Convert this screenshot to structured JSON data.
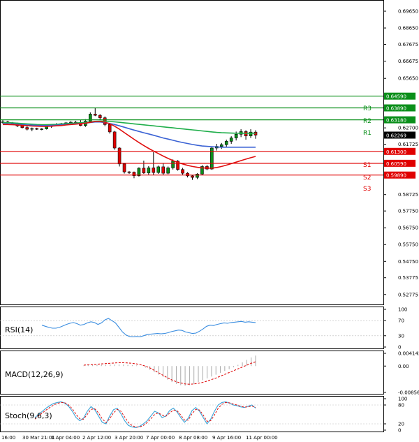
{
  "chart_data": [
    {
      "type": "candlestick",
      "panel": "price",
      "y_ticks": [
        "0.69650",
        "0.68650",
        "0.67675",
        "0.66675",
        "0.65650",
        "0.62700",
        "0.61725",
        "0.58725",
        "0.57750",
        "0.56750",
        "0.55750",
        "0.54750",
        "0.53775",
        "0.52775"
      ],
      "y_tick_values": [
        0.6965,
        0.6865,
        0.67675,
        0.66675,
        0.6565,
        0.627,
        0.61725,
        0.58725,
        0.5775,
        0.5675,
        0.5575,
        0.5475,
        0.53775,
        0.52775
      ],
      "ylim": [
        0.5235,
        0.7015
      ],
      "x_ticks": [
        "16:00",
        "30 Mar 21:01",
        "1 Apr 04:00",
        "2 Apr 12:00",
        "3 Apr 20:00",
        "7 Apr 00:00",
        "8 Apr 08:00",
        "9 Apr 16:00",
        "11 Apr 00:00"
      ],
      "current_price": "0.62269",
      "current_price_value": 0.62269,
      "levels": [
        {
          "name": "",
          "value": 0.6459,
          "label": "0.64590",
          "color": "#0a8f1a"
        },
        {
          "name": "R3",
          "value": 0.6389,
          "label": "0.63890",
          "color": "#0a8f1a"
        },
        {
          "name": "R2",
          "value": 0.6318,
          "label": "0.63180",
          "color": "#0a8f1a"
        },
        {
          "name": "R1",
          "value": 0.6318,
          "label": "",
          "color": "#0a8f1a"
        },
        {
          "name": "S1",
          "value": 0.613,
          "label": "0.61300",
          "color": "#e00000"
        },
        {
          "name": "S2",
          "value": 0.6059,
          "label": "0.60590",
          "color": "#e00000"
        },
        {
          "name": "S3",
          "value": 0.5989,
          "label": "0.59890",
          "color": "#e00000"
        }
      ],
      "candles": [
        {
          "o": 0.6302,
          "h": 0.6318,
          "l": 0.6295,
          "c": 0.6306
        },
        {
          "o": 0.6306,
          "h": 0.6312,
          "l": 0.6296,
          "c": 0.63
        },
        {
          "o": 0.63,
          "h": 0.6305,
          "l": 0.629,
          "c": 0.6296
        },
        {
          "o": 0.6296,
          "h": 0.6301,
          "l": 0.6275,
          "c": 0.6282
        },
        {
          "o": 0.6282,
          "h": 0.6292,
          "l": 0.6266,
          "c": 0.6272
        },
        {
          "o": 0.6272,
          "h": 0.6284,
          "l": 0.6255,
          "c": 0.6262
        },
        {
          "o": 0.6262,
          "h": 0.6272,
          "l": 0.625,
          "c": 0.6266
        },
        {
          "o": 0.6266,
          "h": 0.6271,
          "l": 0.6258,
          "c": 0.6262
        },
        {
          "o": 0.6262,
          "h": 0.6268,
          "l": 0.6256,
          "c": 0.6264
        },
        {
          "o": 0.6264,
          "h": 0.6281,
          "l": 0.626,
          "c": 0.6278
        },
        {
          "o": 0.6278,
          "h": 0.629,
          "l": 0.627,
          "c": 0.6286
        },
        {
          "o": 0.6286,
          "h": 0.6298,
          "l": 0.628,
          "c": 0.6292
        },
        {
          "o": 0.6292,
          "h": 0.63,
          "l": 0.6285,
          "c": 0.6295
        },
        {
          "o": 0.6295,
          "h": 0.6305,
          "l": 0.6288,
          "c": 0.63
        },
        {
          "o": 0.63,
          "h": 0.631,
          "l": 0.6292,
          "c": 0.6304
        },
        {
          "o": 0.6304,
          "h": 0.6312,
          "l": 0.629,
          "c": 0.6298
        },
        {
          "o": 0.6298,
          "h": 0.6318,
          "l": 0.628,
          "c": 0.6284
        },
        {
          "o": 0.6284,
          "h": 0.6322,
          "l": 0.6276,
          "c": 0.631
        },
        {
          "o": 0.631,
          "h": 0.6362,
          "l": 0.6305,
          "c": 0.6352
        },
        {
          "o": 0.6352,
          "h": 0.6388,
          "l": 0.634,
          "c": 0.6345
        },
        {
          "o": 0.6345,
          "h": 0.6352,
          "l": 0.632,
          "c": 0.633
        },
        {
          "o": 0.633,
          "h": 0.6338,
          "l": 0.628,
          "c": 0.629
        },
        {
          "o": 0.629,
          "h": 0.6296,
          "l": 0.6236,
          "c": 0.6246
        },
        {
          "o": 0.6246,
          "h": 0.6252,
          "l": 0.614,
          "c": 0.615
        },
        {
          "o": 0.615,
          "h": 0.6155,
          "l": 0.604,
          "c": 0.6055
        },
        {
          "o": 0.6055,
          "h": 0.606,
          "l": 0.5998,
          "c": 0.6008
        },
        {
          "o": 0.6008,
          "h": 0.6012,
          "l": 0.5996,
          "c": 0.6006
        },
        {
          "o": 0.6006,
          "h": 0.601,
          "l": 0.597,
          "c": 0.5985
        },
        {
          "o": 0.5985,
          "h": 0.6035,
          "l": 0.598,
          "c": 0.603
        },
        {
          "o": 0.603,
          "h": 0.6075,
          "l": 0.5996,
          "c": 0.6002
        },
        {
          "o": 0.6002,
          "h": 0.6042,
          "l": 0.5992,
          "c": 0.6032
        },
        {
          "o": 0.6032,
          "h": 0.6125,
          "l": 0.599,
          "c": 0.6004
        },
        {
          "o": 0.6004,
          "h": 0.6045,
          "l": 0.5996,
          "c": 0.6038
        },
        {
          "o": 0.6038,
          "h": 0.606,
          "l": 0.599,
          "c": 0.6
        },
        {
          "o": 0.6,
          "h": 0.604,
          "l": 0.5994,
          "c": 0.6032
        },
        {
          "o": 0.6032,
          "h": 0.6082,
          "l": 0.6022,
          "c": 0.6072
        },
        {
          "o": 0.6072,
          "h": 0.6078,
          "l": 0.6015,
          "c": 0.6022
        },
        {
          "o": 0.6022,
          "h": 0.6032,
          "l": 0.5992,
          "c": 0.6
        },
        {
          "o": 0.6,
          "h": 0.6006,
          "l": 0.5975,
          "c": 0.5984
        },
        {
          "o": 0.5984,
          "h": 0.599,
          "l": 0.596,
          "c": 0.5975
        },
        {
          "o": 0.5975,
          "h": 0.6,
          "l": 0.5965,
          "c": 0.5995
        },
        {
          "o": 0.5995,
          "h": 0.6048,
          "l": 0.599,
          "c": 0.604
        },
        {
          "o": 0.604,
          "h": 0.605,
          "l": 0.6018,
          "c": 0.6025
        },
        {
          "o": 0.6025,
          "h": 0.6155,
          "l": 0.602,
          "c": 0.615
        },
        {
          "o": 0.615,
          "h": 0.6175,
          "l": 0.6135,
          "c": 0.616
        },
        {
          "o": 0.616,
          "h": 0.618,
          "l": 0.6145,
          "c": 0.617
        },
        {
          "o": 0.617,
          "h": 0.62,
          "l": 0.6155,
          "c": 0.619
        },
        {
          "o": 0.619,
          "h": 0.622,
          "l": 0.6175,
          "c": 0.621
        },
        {
          "o": 0.621,
          "h": 0.6248,
          "l": 0.6195,
          "c": 0.6232
        },
        {
          "o": 0.6232,
          "h": 0.6262,
          "l": 0.6215,
          "c": 0.6248
        },
        {
          "o": 0.6248,
          "h": 0.6256,
          "l": 0.62,
          "c": 0.6222
        },
        {
          "o": 0.6222,
          "h": 0.6262,
          "l": 0.621,
          "c": 0.6245
        },
        {
          "o": 0.6245,
          "h": 0.6256,
          "l": 0.6205,
          "c": 0.6227
        }
      ],
      "ma_green": [
        0.6302,
        0.6301,
        0.63,
        0.6298,
        0.6296,
        0.6294,
        0.6292,
        0.629,
        0.6289,
        0.6289,
        0.629,
        0.6291,
        0.6293,
        0.6295,
        0.6297,
        0.6299,
        0.6301,
        0.6303,
        0.6306,
        0.6309,
        0.631,
        0.631,
        0.6308,
        0.6306,
        0.6303,
        0.63,
        0.6297,
        0.6294,
        0.6291,
        0.6288,
        0.6285,
        0.6282,
        0.6279,
        0.6276,
        0.6273,
        0.627,
        0.6267,
        0.6264,
        0.6261,
        0.6258,
        0.6255,
        0.6252,
        0.6249,
        0.6246,
        0.6243,
        0.6241,
        0.624,
        0.6239,
        0.6238,
        0.6238,
        0.6238,
        0.6238,
        0.6238
      ],
      "ma_blue": [
        0.6295,
        0.6294,
        0.6293,
        0.6291,
        0.6289,
        0.6287,
        0.6286,
        0.6285,
        0.6284,
        0.6284,
        0.6285,
        0.6286,
        0.6288,
        0.629,
        0.6292,
        0.6294,
        0.6296,
        0.6298,
        0.6302,
        0.6305,
        0.6305,
        0.6302,
        0.6296,
        0.629,
        0.6282,
        0.6274,
        0.6265,
        0.6257,
        0.6249,
        0.6241,
        0.6234,
        0.6226,
        0.6218,
        0.621,
        0.6203,
        0.6196,
        0.6189,
        0.6183,
        0.6177,
        0.6171,
        0.6166,
        0.6162,
        0.616,
        0.6158,
        0.6156,
        0.6155,
        0.6155,
        0.6155,
        0.6155,
        0.6155,
        0.6155,
        0.6155,
        0.6155
      ],
      "ma_red": [
        0.629,
        0.629,
        0.6289,
        0.6287,
        0.6285,
        0.6283,
        0.6281,
        0.628,
        0.6279,
        0.6279,
        0.628,
        0.6282,
        0.6284,
        0.6287,
        0.629,
        0.6292,
        0.6295,
        0.6298,
        0.6303,
        0.6308,
        0.6308,
        0.6304,
        0.6294,
        0.628,
        0.6262,
        0.6242,
        0.6222,
        0.6202,
        0.6183,
        0.6165,
        0.6148,
        0.6132,
        0.6117,
        0.6102,
        0.6088,
        0.6075,
        0.6064,
        0.6055,
        0.6047,
        0.604,
        0.6035,
        0.6032,
        0.603,
        0.603,
        0.6034,
        0.604,
        0.6048,
        0.6057,
        0.6066,
        0.6075,
        0.6084,
        0.6092,
        0.61
      ]
    },
    {
      "type": "line",
      "panel": "rsi",
      "title": "RSI(14)",
      "y_ticks": [
        "100",
        "70",
        "30",
        "0"
      ],
      "ylim": [
        0,
        100
      ],
      "values": [
        58,
        55,
        52,
        50,
        50,
        52,
        56,
        60,
        63,
        65,
        62,
        58,
        60,
        64,
        67,
        65,
        60,
        64,
        72,
        76,
        70,
        64,
        52,
        40,
        32,
        28,
        27,
        28,
        27,
        30,
        33,
        34,
        35,
        36,
        35,
        36,
        38,
        41,
        43,
        45,
        44,
        40,
        38,
        36,
        37,
        42,
        48,
        55,
        58,
        57,
        60,
        62,
        64,
        63,
        65,
        66,
        67,
        68,
        66,
        67,
        66,
        65
      ]
    },
    {
      "type": "bar",
      "panel": "macd",
      "title": "MACD(12,26,9)",
      "y_ticks": [
        "0.004142",
        "0.00",
        "-0.008565"
      ],
      "ylim": [
        -0.008565,
        0.004142
      ],
      "histogram": [
        0.0002,
        0.0003,
        0.0003,
        0.0004,
        0.0004,
        0.0004,
        0.0005,
        0.0005,
        0.0005,
        0.0005,
        0.0004,
        0.0003,
        0.0002,
        0.0,
        -0.0005,
        -0.0012,
        -0.002,
        -0.0028,
        -0.0036,
        -0.0044,
        -0.0052,
        -0.0058,
        -0.0062,
        -0.0064,
        -0.0062,
        -0.0058,
        -0.0052,
        -0.0046,
        -0.004,
        -0.0034,
        -0.0028,
        -0.0022,
        -0.0016,
        -0.001,
        -0.0004,
        0.0004,
        0.0012,
        0.002,
        0.0028,
        0.0034
      ],
      "signal": [
        0.0003,
        0.0004,
        0.0005,
        0.0006,
        0.0007,
        0.0008,
        0.0009,
        0.001,
        0.0011,
        0.0011,
        0.001,
        0.0009,
        0.0007,
        0.0004,
        0.0,
        -0.0006,
        -0.0014,
        -0.0022,
        -0.003,
        -0.0038,
        -0.0045,
        -0.0051,
        -0.0055,
        -0.0058,
        -0.0059,
        -0.0058,
        -0.0056,
        -0.0053,
        -0.0049,
        -0.0044,
        -0.0039,
        -0.0033,
        -0.0027,
        -0.0021,
        -0.0015,
        -0.0009,
        -0.0003,
        0.0003,
        0.0009,
        0.0014
      ]
    },
    {
      "type": "line",
      "panel": "stoch",
      "title": "Stoch(9,6,3)",
      "y_ticks": [
        "100",
        "80",
        "20",
        "0"
      ],
      "ylim": [
        0,
        100
      ],
      "main": [
        40,
        50,
        60,
        70,
        78,
        85,
        88,
        90,
        86,
        76,
        60,
        40,
        30,
        38,
        60,
        75,
        65,
        45,
        25,
        20,
        45,
        65,
        70,
        52,
        30,
        15,
        10,
        8,
        12,
        20,
        30,
        45,
        60,
        55,
        40,
        45,
        62,
        70,
        58,
        40,
        25,
        38,
        62,
        72,
        60,
        40,
        20,
        35,
        60,
        80,
        88,
        90,
        86,
        80,
        78,
        74,
        72,
        76,
        80,
        70
      ],
      "signal": [
        35,
        45,
        55,
        64,
        72,
        80,
        85,
        88,
        87,
        80,
        68,
        50,
        36,
        35,
        50,
        66,
        68,
        55,
        36,
        24,
        36,
        55,
        66,
        60,
        42,
        24,
        14,
        10,
        10,
        15,
        24,
        36,
        50,
        55,
        48,
        44,
        54,
        64,
        62,
        48,
        32,
        32,
        52,
        66,
        64,
        48,
        28,
        30,
        48,
        70,
        82,
        88,
        87,
        83,
        80,
        76,
        73,
        74,
        77,
        72
      ]
    }
  ]
}
